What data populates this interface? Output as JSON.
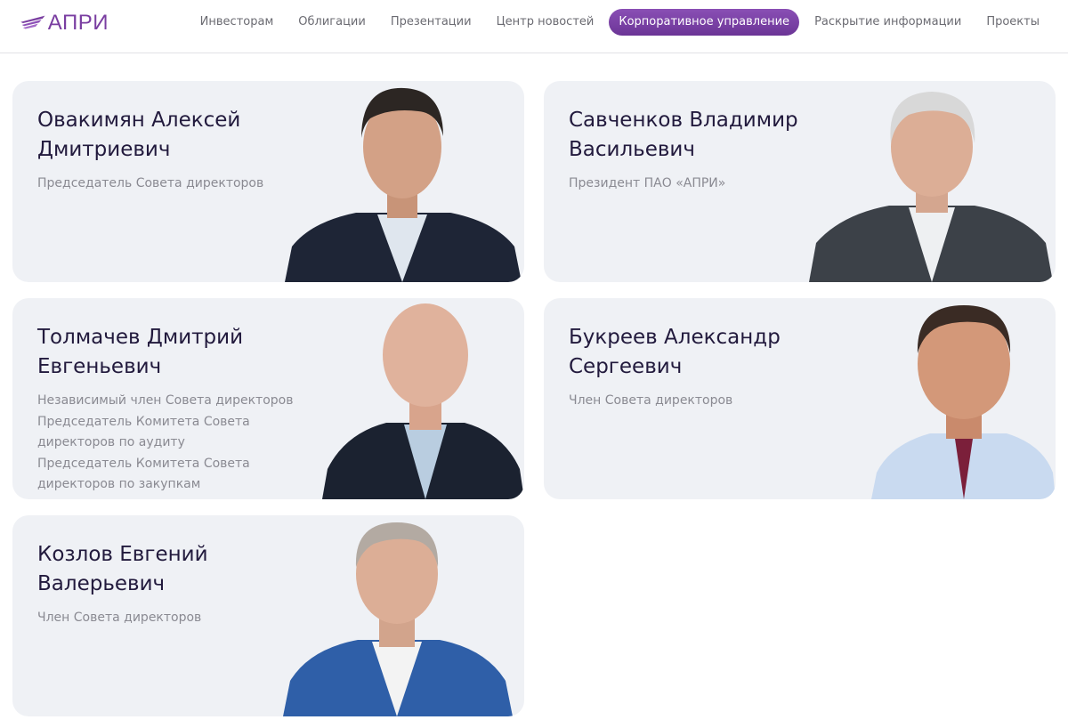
{
  "brand": {
    "logo_text": "АПРИ",
    "accent_color": "#7a3ea1"
  },
  "nav": {
    "items": [
      {
        "label": "Инвесторам",
        "active": false
      },
      {
        "label": "Облигации",
        "active": false
      },
      {
        "label": "Презентации",
        "active": false
      },
      {
        "label": "Центр новостей",
        "active": false
      },
      {
        "label": "Корпоративное управление",
        "active": true
      },
      {
        "label": "Раскрытие информации",
        "active": false
      },
      {
        "label": "Проекты",
        "active": false
      }
    ]
  },
  "directors": [
    {
      "name": "Овакимян Алексей Дмитриевич",
      "roles": [
        "Председатель Совета директоров"
      ],
      "photo": "portrait-photo"
    },
    {
      "name": "Савченков Владимир Васильевич",
      "roles": [
        "Президент ПАО «АПРИ»"
      ],
      "photo": "portrait-photo"
    },
    {
      "name": "Толмачев Дмитрий Евгеньевич",
      "roles": [
        "Независимый член Совета директоров",
        "Председатель Комитета Совета директоров по аудиту",
        "Председатель Комитета Совета директоров по закупкам"
      ],
      "photo": "portrait-photo"
    },
    {
      "name": "Букреев Александр Сергеевич",
      "roles": [
        "Член Совета директоров"
      ],
      "photo": "portrait-photo"
    },
    {
      "name": "Козлов Евгений Валерьевич",
      "roles": [
        "Член Совета директоров"
      ],
      "photo": "portrait-photo"
    }
  ]
}
